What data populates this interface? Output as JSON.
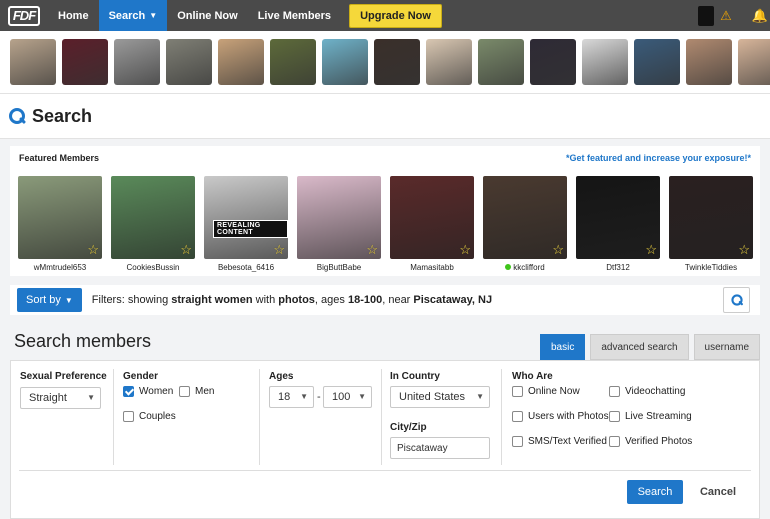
{
  "nav": {
    "logo": "FDF",
    "items": [
      {
        "label": "Home"
      },
      {
        "label": "Search"
      },
      {
        "label": "Online Now"
      },
      {
        "label": "Live Members"
      }
    ],
    "upgrade_label": "Upgrade Now"
  },
  "strip_colors": [
    "#b7a38c",
    "#5b1f2a",
    "#9a9a9a",
    "#7f7f75",
    "#c8a27a",
    "#5d6a3a",
    "#6fb2c9",
    "#3a2f2a",
    "#d9c7b2",
    "#7a8a6a",
    "#2e2a35",
    "#d9d9d9",
    "#3a5b7a",
    "#b08a70",
    "#d7b59a"
  ],
  "page_title": "Search",
  "featured": {
    "label": "Featured Members",
    "link": "*Get featured and increase your exposure!*",
    "members": [
      {
        "name": "wMmtrudel653",
        "color": "#8a9a7a",
        "online": false
      },
      {
        "name": "CookiesBussin",
        "color": "#5a8a5a",
        "online": false
      },
      {
        "name": "Bebesota_6416",
        "color": "#c9c9c9",
        "online": false,
        "badge": "REVEALING CONTENT"
      },
      {
        "name": "BigButtBabe",
        "color": "#d9b9c9",
        "online": false
      },
      {
        "name": "Mamasitabb",
        "color": "#5a2a2a",
        "online": false
      },
      {
        "name": "kkclifford",
        "color": "#4a3a30",
        "online": true
      },
      {
        "name": "Dtf312",
        "color": "#151515",
        "online": false
      },
      {
        "name": "TwinkleTiddies",
        "color": "#2a2020",
        "online": false
      }
    ]
  },
  "filterbar": {
    "sort_label": "Sort by",
    "prefix": "Filters: showing ",
    "who": "straight women",
    "with_text": " with ",
    "photos": "photos",
    "ages_text": ", ages ",
    "ages": "18-100",
    "near_text": ", near ",
    "location": "Piscataway, NJ"
  },
  "panel": {
    "title": "Search members",
    "tabs": [
      {
        "label": "basic"
      },
      {
        "label": "advanced search"
      },
      {
        "label": "username"
      }
    ],
    "sexual_pref": {
      "label": "Sexual Preference",
      "value": "Straight"
    },
    "gender": {
      "label": "Gender",
      "women": "Women",
      "men": "Men",
      "couples": "Couples"
    },
    "ages": {
      "label": "Ages",
      "min": "18",
      "max": "100",
      "sep": "-"
    },
    "country": {
      "label": "In Country",
      "value": "United States"
    },
    "cityzip": {
      "label": "City/Zip",
      "value": "Piscataway"
    },
    "who_are": {
      "label": "Who Are",
      "online_now": "Online Now",
      "videochatting": "Videochatting",
      "with_photos": "Users with Photos",
      "live_streaming": "Live Streaming",
      "sms": "SMS/Text Verified",
      "verified_photos": "Verified Photos"
    },
    "search_label": "Search",
    "cancel_label": "Cancel"
  },
  "colors": {
    "accent": "#1f77c9",
    "upgrade": "#f5d83a",
    "nav": "#4a4a4a"
  }
}
